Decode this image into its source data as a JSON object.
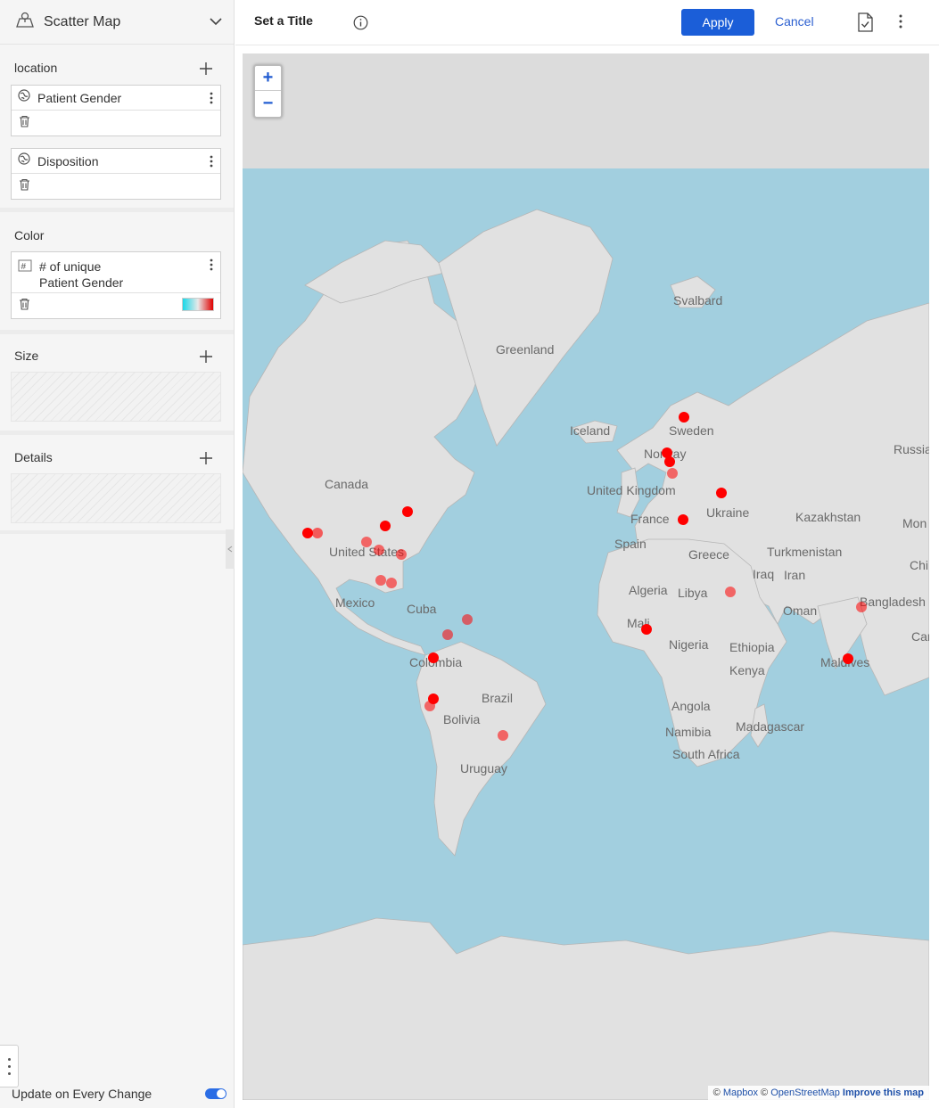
{
  "chart_type": {
    "label": "Scatter Map",
    "icon": "map-icon"
  },
  "sections": {
    "location": {
      "title": "location",
      "fields": [
        "Patient Gender",
        "Disposition"
      ]
    },
    "color": {
      "title": "Color",
      "field_line1": "# of unique",
      "field_line2": "Patient Gender"
    },
    "size": {
      "title": "Size"
    },
    "details": {
      "title": "Details"
    }
  },
  "update_label": "Update on Every Change",
  "update_toggle_on": true,
  "header": {
    "title": "Set a Title",
    "apply": "Apply",
    "cancel": "Cancel"
  },
  "map": {
    "zoom_in": "+",
    "zoom_out": "−",
    "labels": [
      "Svalbard",
      "Greenland",
      "Iceland",
      "Sweden",
      "Norway",
      "Russia",
      "Canada",
      "United Kingdom",
      "Ukraine",
      "France",
      "Kazakhstan",
      "Mon",
      "Spain",
      "Greece",
      "Turkmenistan",
      "Chi",
      "United States",
      "Iraq",
      "Iran",
      "Algeria",
      "Libya",
      "Mexico",
      "Cuba",
      "Oman",
      "Bangladesh",
      "Mali",
      "Cam",
      "Nigeria",
      "Ethiopia",
      "Colombia",
      "Maldives",
      "Kenya",
      "Brazil",
      "Bolivia",
      "Angola",
      "Namibia",
      "Madagascar",
      "South Africa",
      "Uruguay"
    ],
    "attribution": {
      "copy1": "©",
      "mapbox": "Mapbox",
      "copy2": "©",
      "osm": "OpenStreetMap",
      "improve": "Improve this map"
    }
  },
  "colors": {
    "ocean": "#a2cfdf",
    "land": "#e1e1e1",
    "marker": "#ff0000",
    "accent": "#1b5ed8"
  }
}
